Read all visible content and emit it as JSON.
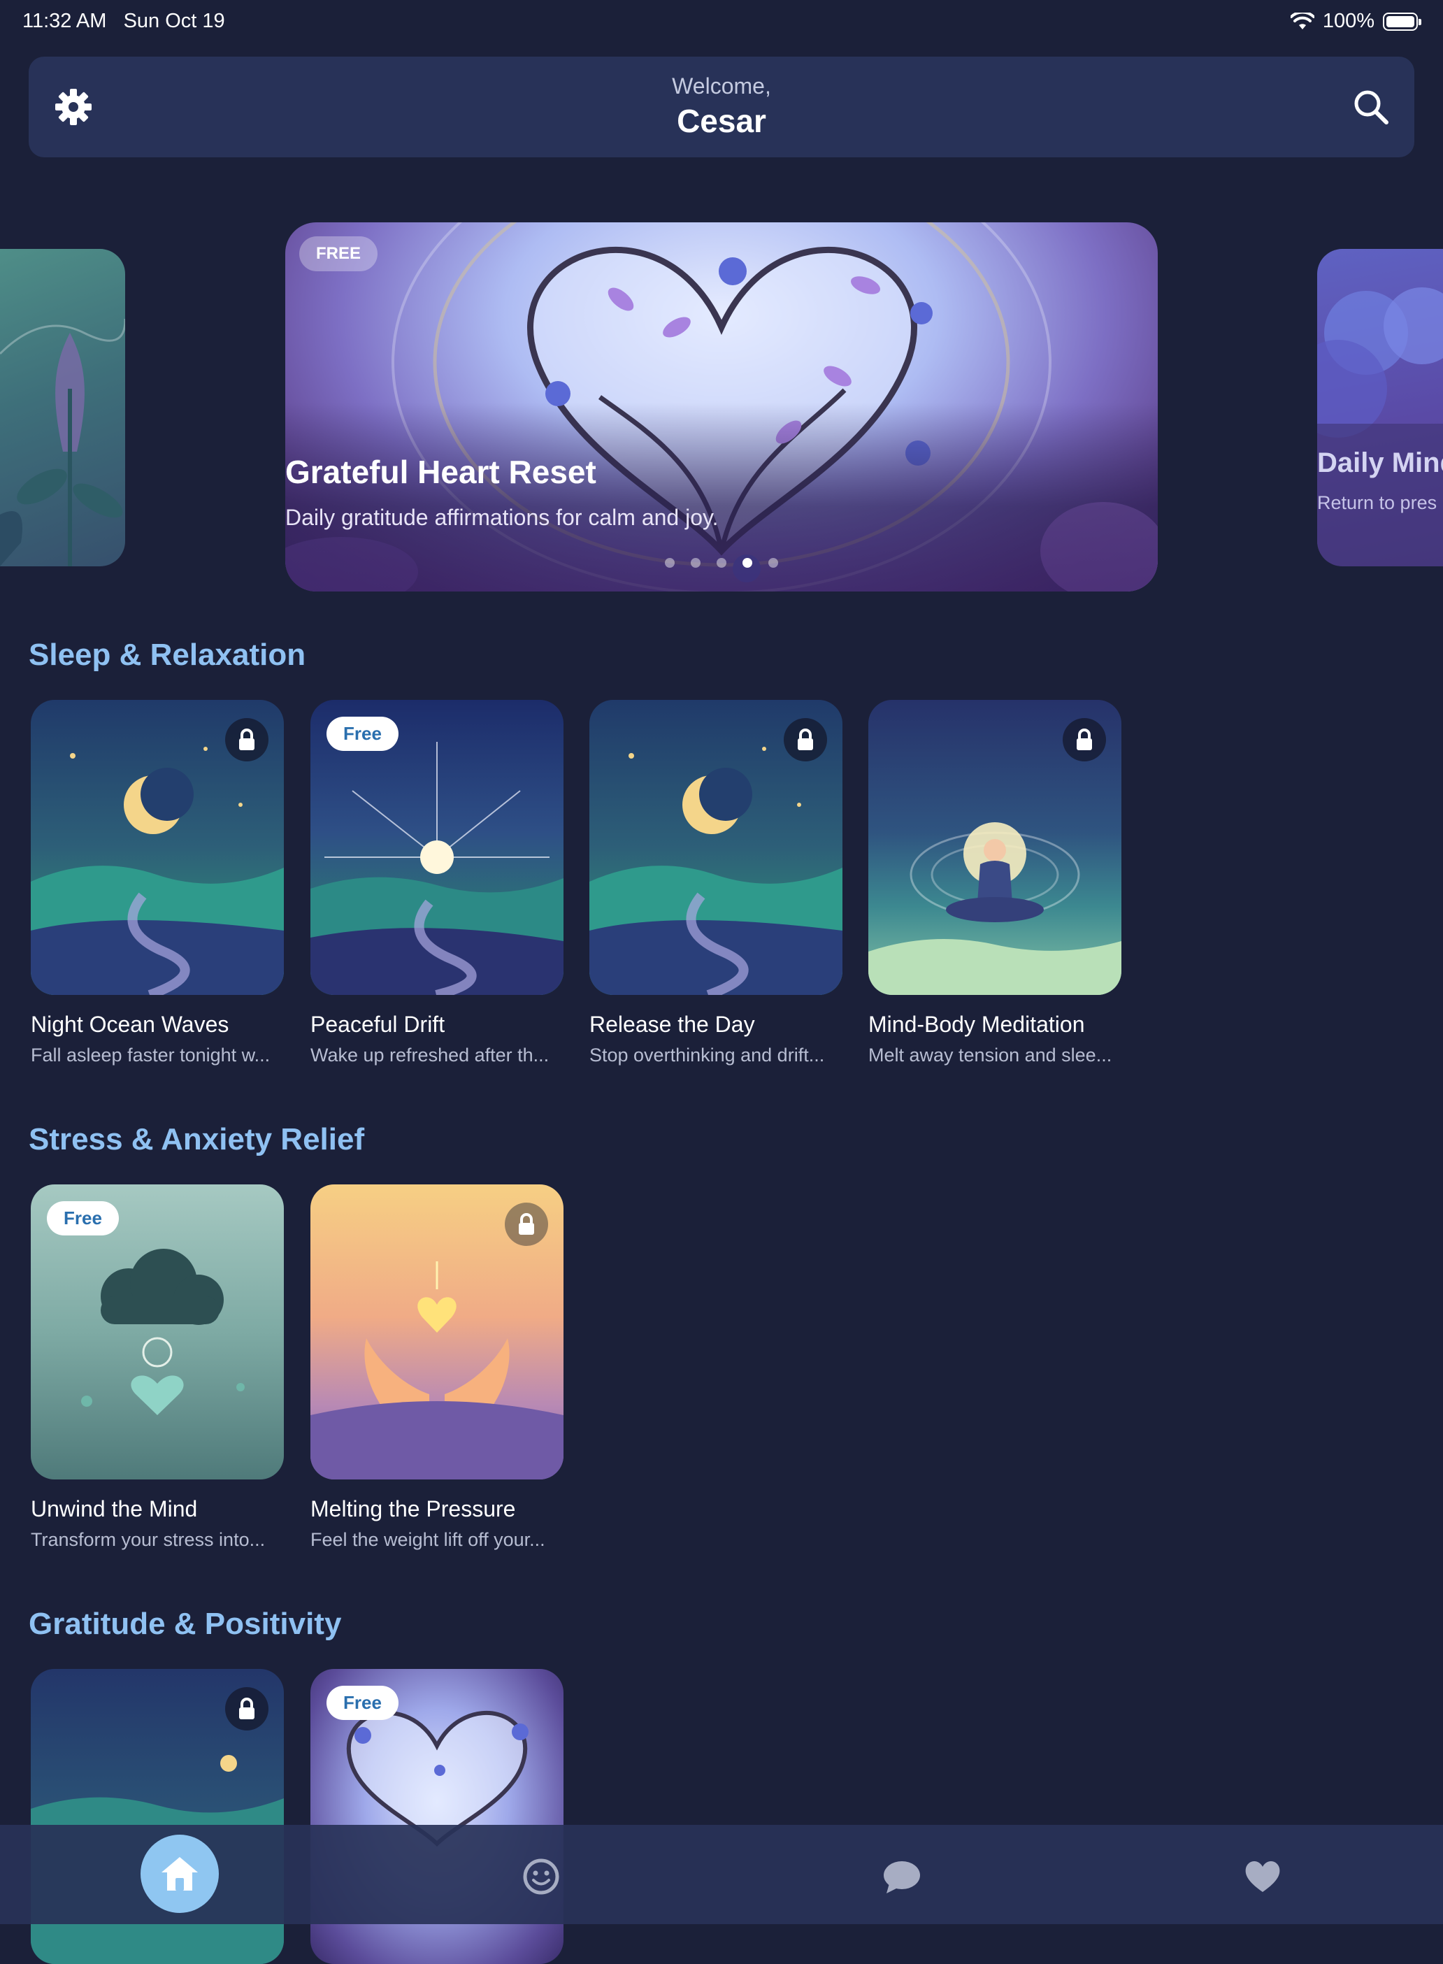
{
  "status_bar": {
    "time": "11:32 AM",
    "date": "Sun Oct 19",
    "battery": "100%"
  },
  "header": {
    "greeting": "Welcome,",
    "name": "Cesar",
    "settings_icon": "gear-icon",
    "search_icon": "search-icon"
  },
  "carousel": {
    "active_index": 3,
    "dot_count": 5,
    "featured": {
      "badge": "FREE",
      "title": "Grateful Heart Reset",
      "subtitle": "Daily gratitude affirmations for calm and joy."
    },
    "next": {
      "title": "Daily Mind",
      "subtitle": "Return to pres"
    }
  },
  "sections": [
    {
      "title": "Sleep & Relaxation",
      "cards": [
        {
          "title": "Night Ocean Waves",
          "subtitle": "Fall asleep faster tonight w...",
          "locked": true
        },
        {
          "title": "Peaceful Drift",
          "subtitle": "Wake up refreshed after th...",
          "badge": "Free"
        },
        {
          "title": "Release the Day",
          "subtitle": "Stop overthinking and drift...",
          "locked": true
        },
        {
          "title": "Mind-Body Meditation",
          "subtitle": "Melt away tension and slee...",
          "locked": true
        }
      ]
    },
    {
      "title": "Stress & Anxiety Relief",
      "cards": [
        {
          "title": "Unwind the Mind",
          "subtitle": "Transform your stress into...",
          "badge": "Free"
        },
        {
          "title": "Melting the Pressure",
          "subtitle": "Feel the weight lift off your...",
          "locked": true
        }
      ]
    },
    {
      "title": "Gratitude & Positivity",
      "cards": [
        {
          "locked": true
        },
        {
          "badge": "Free"
        }
      ]
    }
  ],
  "tab_bar": {
    "items": [
      "home-icon",
      "smiley-icon",
      "chat-icon",
      "heart-icon"
    ],
    "active": "home-icon"
  }
}
